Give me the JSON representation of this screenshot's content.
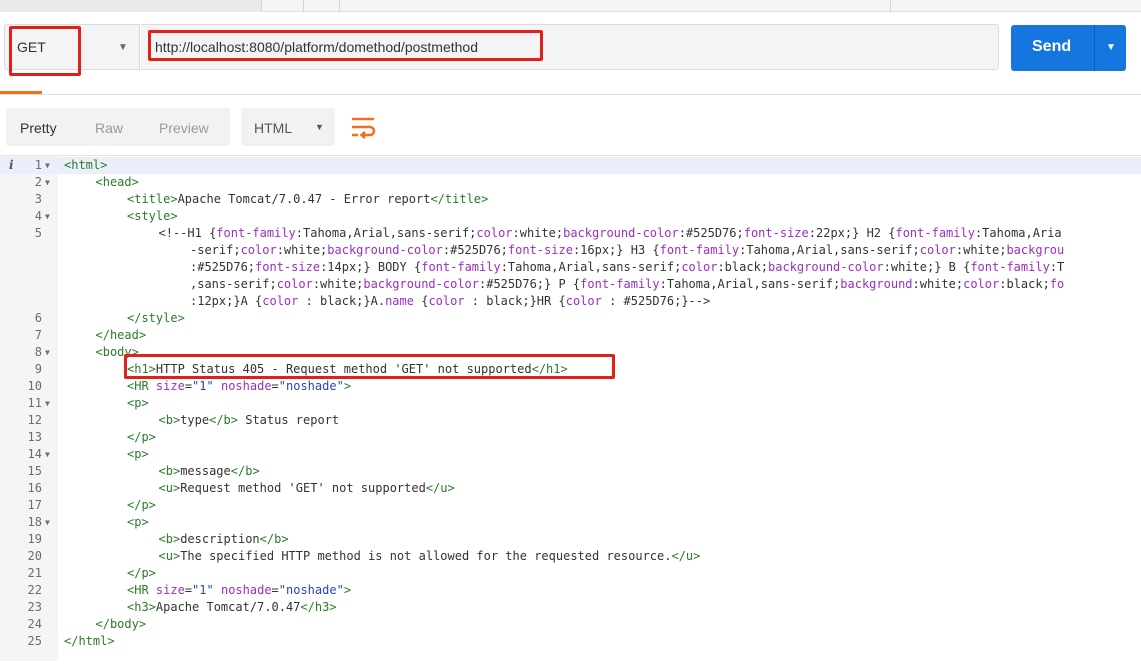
{
  "request": {
    "method": "GET",
    "url": "http://localhost:8080/platform/domethod/postmethod",
    "send_label": "Send"
  },
  "response_toolbar": {
    "tabs": [
      "Pretty",
      "Raw",
      "Preview"
    ],
    "active_tab": "Pretty",
    "format": "HTML"
  },
  "icons": {
    "method_caret": "chevron-down-icon",
    "send_caret": "chevron-down-icon",
    "format_caret": "chevron-down-icon",
    "wrap": "wrap-lines-icon",
    "info": "info-icon"
  },
  "colors": {
    "send_button": "#1676e0",
    "highlight_box": "#e0201a",
    "active_tab_underline": "#f07020",
    "tag": "#2a7b2a",
    "attribute": "#9c2fbf",
    "value": "#2a44b6"
  },
  "info_glyph": "i",
  "code_lines": [
    {
      "n": "1",
      "fold": true,
      "indent": 0,
      "parts": [
        [
          "t",
          "<html>"
        ]
      ]
    },
    {
      "n": "2",
      "fold": true,
      "indent": 1,
      "parts": [
        [
          "t",
          "<head>"
        ]
      ]
    },
    {
      "n": "3",
      "fold": false,
      "indent": 2,
      "parts": [
        [
          "t",
          "<title>"
        ],
        [
          "x",
          "Apache Tomcat/7.0.47 - Error report"
        ],
        [
          "t",
          "</title>"
        ]
      ]
    },
    {
      "n": "4",
      "fold": true,
      "indent": 2,
      "parts": [
        [
          "t",
          "<style>"
        ]
      ]
    },
    {
      "n": "5",
      "fold": false,
      "indent": 3,
      "parts": [
        [
          "x",
          "<!--H1 {"
        ],
        [
          "a",
          "font-family"
        ],
        [
          "x",
          ":Tahoma,Arial,sans-serif;"
        ],
        [
          "a",
          "color"
        ],
        [
          "x",
          ":white;"
        ],
        [
          "a",
          "background-color"
        ],
        [
          "x",
          ":#525D76;"
        ],
        [
          "a",
          "font-size"
        ],
        [
          "x",
          ":22px;} H2 {"
        ],
        [
          "a",
          "font-family"
        ],
        [
          "x",
          ":Tahoma,Aria"
        ]
      ]
    },
    {
      "n": "",
      "fold": false,
      "indent": 4,
      "parts": [
        [
          "x",
          "-serif;"
        ],
        [
          "a",
          "color"
        ],
        [
          "x",
          ":white;"
        ],
        [
          "a",
          "background-color"
        ],
        [
          "x",
          ":#525D76;"
        ],
        [
          "a",
          "font-size"
        ],
        [
          "x",
          ":16px;} H3 {"
        ],
        [
          "a",
          "font-family"
        ],
        [
          "x",
          ":Tahoma,Arial,sans-serif;"
        ],
        [
          "a",
          "color"
        ],
        [
          "x",
          ":white;"
        ],
        [
          "a",
          "backgrou"
        ]
      ]
    },
    {
      "n": "",
      "fold": false,
      "indent": 4,
      "parts": [
        [
          "x",
          ":#525D76;"
        ],
        [
          "a",
          "font-size"
        ],
        [
          "x",
          ":14px;} BODY {"
        ],
        [
          "a",
          "font-family"
        ],
        [
          "x",
          ":Tahoma,Arial,sans-serif;"
        ],
        [
          "a",
          "color"
        ],
        [
          "x",
          ":black;"
        ],
        [
          "a",
          "background-color"
        ],
        [
          "x",
          ":white;} B {"
        ],
        [
          "a",
          "font-family"
        ],
        [
          "x",
          ":T"
        ]
      ]
    },
    {
      "n": "",
      "fold": false,
      "indent": 4,
      "parts": [
        [
          "x",
          ",sans-serif;"
        ],
        [
          "a",
          "color"
        ],
        [
          "x",
          ":white;"
        ],
        [
          "a",
          "background-color"
        ],
        [
          "x",
          ":#525D76;} P {"
        ],
        [
          "a",
          "font-family"
        ],
        [
          "x",
          ":Tahoma,Arial,sans-serif;"
        ],
        [
          "a",
          "background"
        ],
        [
          "x",
          ":white;"
        ],
        [
          "a",
          "color"
        ],
        [
          "x",
          ":black;"
        ],
        [
          "a",
          "fo"
        ]
      ]
    },
    {
      "n": "",
      "fold": false,
      "indent": 4,
      "parts": [
        [
          "x",
          ":12px;}A {"
        ],
        [
          "a",
          "color"
        ],
        [
          "x",
          " : black;}A."
        ],
        [
          "a",
          "name"
        ],
        [
          "x",
          " {"
        ],
        [
          "a",
          "color"
        ],
        [
          "x",
          " : black;}HR {"
        ],
        [
          "a",
          "color"
        ],
        [
          "x",
          " : #525D76;}-->"
        ]
      ]
    },
    {
      "n": "6",
      "fold": false,
      "indent": 2,
      "parts": [
        [
          "t",
          "</style>"
        ]
      ]
    },
    {
      "n": "7",
      "fold": false,
      "indent": 1,
      "parts": [
        [
          "t",
          "</head>"
        ]
      ]
    },
    {
      "n": "8",
      "fold": true,
      "indent": 1,
      "parts": [
        [
          "t",
          "<body>"
        ]
      ]
    },
    {
      "n": "9",
      "fold": false,
      "indent": 2,
      "parts": [
        [
          "t",
          "<h1>"
        ],
        [
          "x",
          "HTTP Status 405 - Request method 'GET' not supported"
        ],
        [
          "t",
          "</h1>"
        ]
      ]
    },
    {
      "n": "10",
      "fold": false,
      "indent": 2,
      "parts": [
        [
          "t",
          "<HR "
        ],
        [
          "a",
          "size"
        ],
        [
          "x",
          "="
        ],
        [
          "v",
          "\"1\""
        ],
        [
          "x",
          " "
        ],
        [
          "a",
          "noshade"
        ],
        [
          "x",
          "="
        ],
        [
          "v",
          "\"noshade\""
        ],
        [
          "t",
          ">"
        ]
      ]
    },
    {
      "n": "11",
      "fold": true,
      "indent": 2,
      "parts": [
        [
          "t",
          "<p>"
        ]
      ]
    },
    {
      "n": "12",
      "fold": false,
      "indent": 3,
      "parts": [
        [
          "t",
          "<b>"
        ],
        [
          "x",
          "type"
        ],
        [
          "t",
          "</b>"
        ],
        [
          "x",
          " Status report"
        ]
      ]
    },
    {
      "n": "13",
      "fold": false,
      "indent": 2,
      "parts": [
        [
          "t",
          "</p>"
        ]
      ]
    },
    {
      "n": "14",
      "fold": true,
      "indent": 2,
      "parts": [
        [
          "t",
          "<p>"
        ]
      ]
    },
    {
      "n": "15",
      "fold": false,
      "indent": 3,
      "parts": [
        [
          "t",
          "<b>"
        ],
        [
          "x",
          "message"
        ],
        [
          "t",
          "</b>"
        ]
      ]
    },
    {
      "n": "16",
      "fold": false,
      "indent": 3,
      "parts": [
        [
          "t",
          "<u>"
        ],
        [
          "x",
          "Request method 'GET' not supported"
        ],
        [
          "t",
          "</u>"
        ]
      ]
    },
    {
      "n": "17",
      "fold": false,
      "indent": 2,
      "parts": [
        [
          "t",
          "</p>"
        ]
      ]
    },
    {
      "n": "18",
      "fold": true,
      "indent": 2,
      "parts": [
        [
          "t",
          "<p>"
        ]
      ]
    },
    {
      "n": "19",
      "fold": false,
      "indent": 3,
      "parts": [
        [
          "t",
          "<b>"
        ],
        [
          "x",
          "description"
        ],
        [
          "t",
          "</b>"
        ]
      ]
    },
    {
      "n": "20",
      "fold": false,
      "indent": 3,
      "parts": [
        [
          "t",
          "<u>"
        ],
        [
          "x",
          "The specified HTTP method is not allowed for the requested resource."
        ],
        [
          "t",
          "</u>"
        ]
      ]
    },
    {
      "n": "21",
      "fold": false,
      "indent": 2,
      "parts": [
        [
          "t",
          "</p>"
        ]
      ]
    },
    {
      "n": "22",
      "fold": false,
      "indent": 2,
      "parts": [
        [
          "t",
          "<HR "
        ],
        [
          "a",
          "size"
        ],
        [
          "x",
          "="
        ],
        [
          "v",
          "\"1\""
        ],
        [
          "x",
          " "
        ],
        [
          "a",
          "noshade"
        ],
        [
          "x",
          "="
        ],
        [
          "v",
          "\"noshade\""
        ],
        [
          "t",
          ">"
        ]
      ]
    },
    {
      "n": "23",
      "fold": false,
      "indent": 2,
      "parts": [
        [
          "t",
          "<h3>"
        ],
        [
          "x",
          "Apache Tomcat/7.0.47"
        ],
        [
          "t",
          "</h3>"
        ]
      ]
    },
    {
      "n": "24",
      "fold": false,
      "indent": 1,
      "parts": [
        [
          "t",
          "</body>"
        ]
      ]
    },
    {
      "n": "25",
      "fold": false,
      "indent": 0,
      "parts": [
        [
          "t",
          "</html>"
        ]
      ]
    }
  ]
}
